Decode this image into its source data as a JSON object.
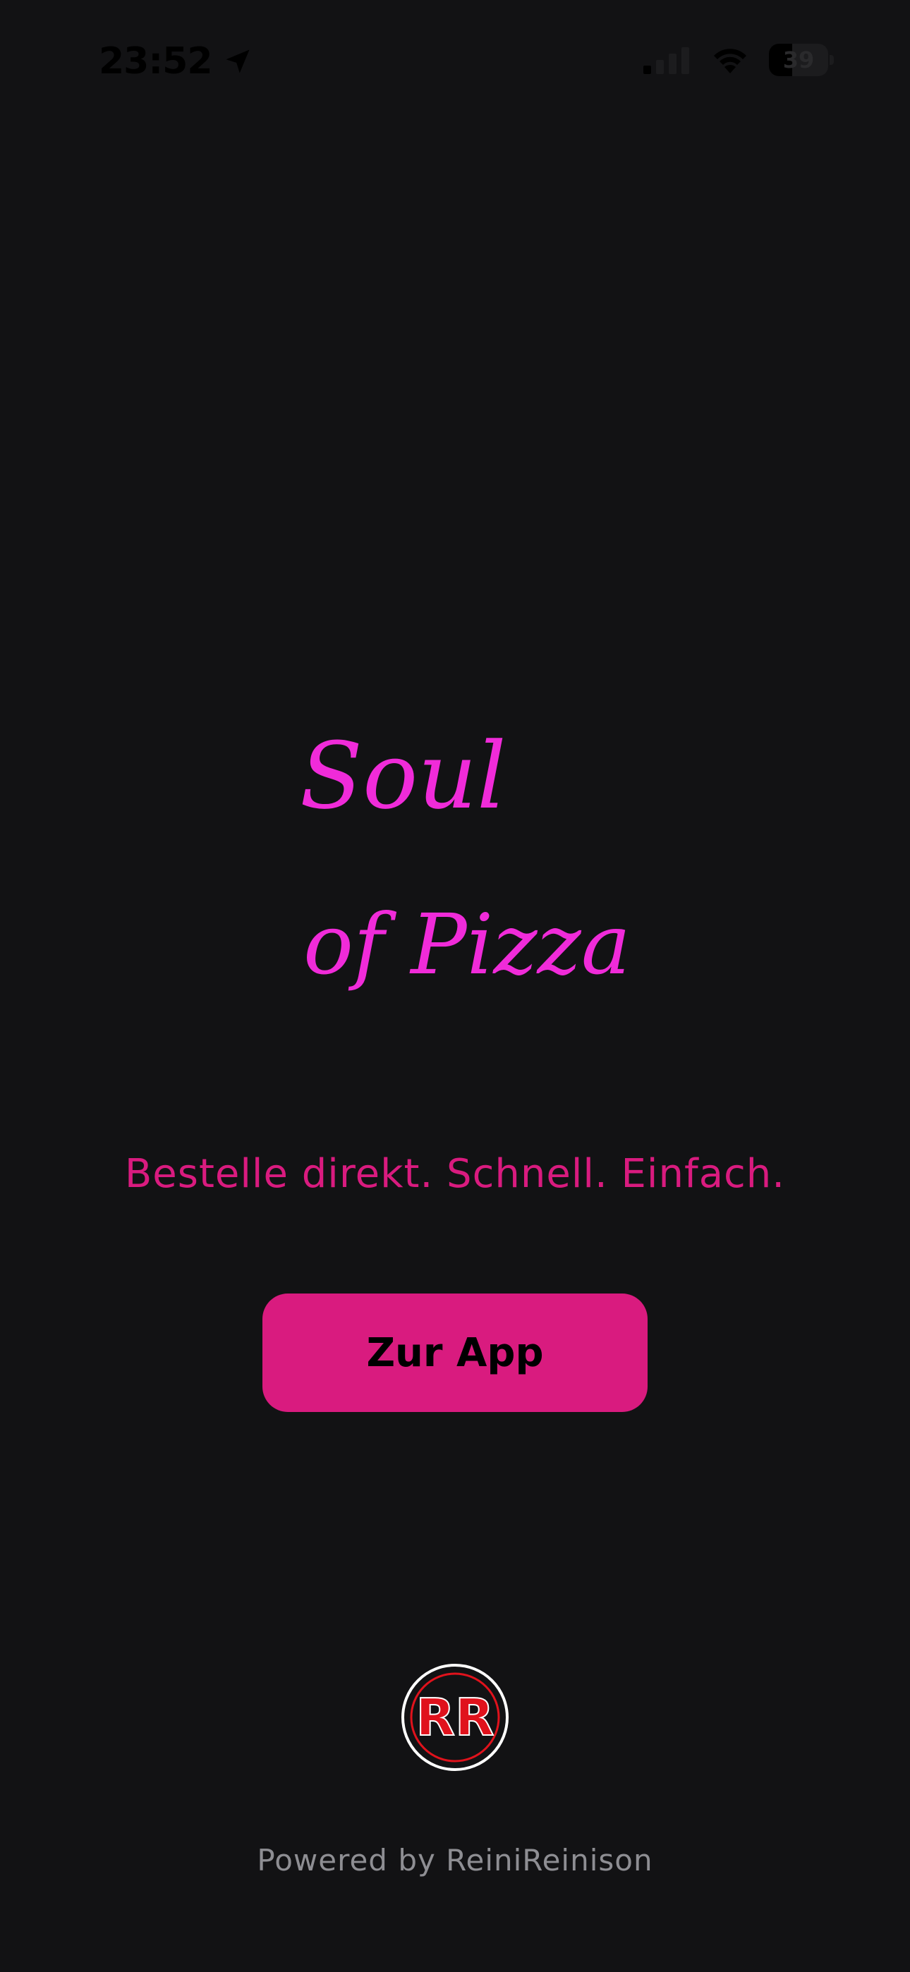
{
  "status_bar": {
    "time": "23:52",
    "battery_level": "39",
    "battery_fraction": 0.39,
    "icons": [
      "location-arrow-icon",
      "cellular-signal-icon",
      "wifi-icon",
      "battery-icon"
    ]
  },
  "brand": {
    "name_line1": "Soul",
    "name_line2": "of Pizza",
    "color": "#f02bd9"
  },
  "tagline": "Bestelle direkt. Schnell. Einfach.",
  "cta": {
    "label": "Zur App",
    "color": "#d91b7f"
  },
  "footer": {
    "badge_initials": "RR",
    "powered_by": "Powered by ReiniReinison"
  },
  "colors": {
    "background": "#121214",
    "accent": "#d91b7f",
    "badge_red": "#e0121c",
    "muted_text": "#8e8e93"
  }
}
